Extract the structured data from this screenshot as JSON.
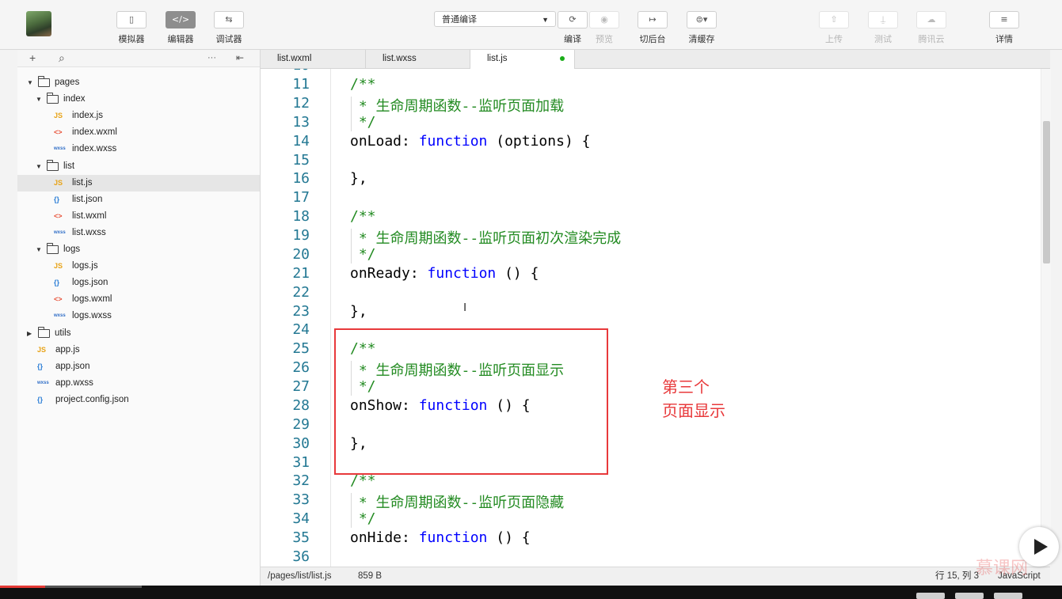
{
  "toolbar": {
    "simulator_label": "模拟器",
    "editor_label": "编辑器",
    "debugger_label": "调试器",
    "compile_mode": "普通编译",
    "compile_label": "编译",
    "preview_label": "预览",
    "background_label": "切后台",
    "clear_cache_label": "清缓存",
    "upload_label": "上传",
    "test_label": "测试",
    "tencent_cloud_label": "腾讯云",
    "details_label": "详情",
    "simulator_icon": "▯",
    "editor_icon": "</>",
    "debugger_icon": "⇆",
    "compile_icon": "⟳",
    "preview_icon": "◉",
    "background_icon": "↦",
    "clear_cache_icon": "⊜▾",
    "upload_icon": "⇧",
    "test_icon": "⍊",
    "tencent_cloud_icon": "☁",
    "details_icon": "≡"
  },
  "sidebar": {
    "add_icon": "+",
    "search_icon": "⌕",
    "more_icon": "···",
    "collapse_icon": "⇤",
    "tree": [
      {
        "label": "pages",
        "type": "folder",
        "open": true,
        "depth": 0
      },
      {
        "label": "index",
        "type": "folder",
        "open": true,
        "depth": 1
      },
      {
        "label": "index.js",
        "type": "js",
        "depth": 2,
        "icon": "JS"
      },
      {
        "label": "index.wxml",
        "type": "wxml",
        "depth": 2,
        "icon": "<>"
      },
      {
        "label": "index.wxss",
        "type": "wxss",
        "depth": 2,
        "icon": "wxss"
      },
      {
        "label": "list",
        "type": "folder",
        "open": true,
        "depth": 1
      },
      {
        "label": "list.js",
        "type": "js",
        "depth": 2,
        "icon": "JS",
        "selected": true
      },
      {
        "label": "list.json",
        "type": "json",
        "depth": 2,
        "icon": "{}"
      },
      {
        "label": "list.wxml",
        "type": "wxml",
        "depth": 2,
        "icon": "<>"
      },
      {
        "label": "list.wxss",
        "type": "wxss",
        "depth": 2,
        "icon": "wxss"
      },
      {
        "label": "logs",
        "type": "folder",
        "open": true,
        "depth": 1
      },
      {
        "label": "logs.js",
        "type": "js",
        "depth": 2,
        "icon": "JS"
      },
      {
        "label": "logs.json",
        "type": "json",
        "depth": 2,
        "icon": "{}"
      },
      {
        "label": "logs.wxml",
        "type": "wxml",
        "depth": 2,
        "icon": "<>"
      },
      {
        "label": "logs.wxss",
        "type": "wxss",
        "depth": 2,
        "icon": "wxss"
      },
      {
        "label": "utils",
        "type": "folder",
        "open": false,
        "depth": 0
      },
      {
        "label": "app.js",
        "type": "js",
        "depth": 0,
        "icon": "JS"
      },
      {
        "label": "app.json",
        "type": "json",
        "depth": 0,
        "icon": "{}"
      },
      {
        "label": "app.wxss",
        "type": "wxss",
        "depth": 0,
        "icon": "wxss"
      },
      {
        "label": "project.config.json",
        "type": "json",
        "depth": 0,
        "icon": "{}"
      }
    ]
  },
  "tabs": [
    {
      "label": "list.wxml",
      "active": false
    },
    {
      "label": "list.wxss",
      "active": false
    },
    {
      "label": "list.js",
      "active": true,
      "modified": true
    }
  ],
  "code": {
    "first_partial_line": "10",
    "lines": [
      {
        "n": "11",
        "parts": [
          [
            "cm",
            "/**"
          ]
        ]
      },
      {
        "n": "12",
        "parts": [
          [
            "cm",
            " * 生命周期函数--监听页面加载"
          ]
        ]
      },
      {
        "n": "13",
        "parts": [
          [
            "cm",
            " */"
          ]
        ]
      },
      {
        "n": "14",
        "parts": [
          [
            "",
            "onLoad: "
          ],
          [
            "kw",
            "function"
          ],
          [
            "",
            " (options) {"
          ]
        ]
      },
      {
        "n": "15",
        "parts": []
      },
      {
        "n": "16",
        "parts": [
          [
            "",
            "},"
          ]
        ]
      },
      {
        "n": "17",
        "parts": []
      },
      {
        "n": "18",
        "parts": [
          [
            "cm",
            "/**"
          ]
        ]
      },
      {
        "n": "19",
        "parts": [
          [
            "cm",
            " * 生命周期函数--监听页面初次渲染完成"
          ]
        ]
      },
      {
        "n": "20",
        "parts": [
          [
            "cm",
            " */"
          ]
        ]
      },
      {
        "n": "21",
        "parts": [
          [
            "",
            "onReady: "
          ],
          [
            "kw",
            "function"
          ],
          [
            "",
            " () {"
          ]
        ]
      },
      {
        "n": "22",
        "parts": []
      },
      {
        "n": "23",
        "parts": [
          [
            "",
            "},"
          ]
        ]
      },
      {
        "n": "24",
        "parts": []
      },
      {
        "n": "25",
        "parts": [
          [
            "cm",
            "/**"
          ]
        ]
      },
      {
        "n": "26",
        "parts": [
          [
            "cm",
            " * 生命周期函数--监听页面显示"
          ]
        ]
      },
      {
        "n": "27",
        "parts": [
          [
            "cm",
            " */"
          ]
        ]
      },
      {
        "n": "28",
        "parts": [
          [
            "",
            "onShow: "
          ],
          [
            "kw",
            "function"
          ],
          [
            "",
            " () {"
          ]
        ]
      },
      {
        "n": "29",
        "parts": []
      },
      {
        "n": "30",
        "parts": [
          [
            "",
            "},"
          ]
        ]
      },
      {
        "n": "31",
        "parts": []
      },
      {
        "n": "32",
        "parts": [
          [
            "cm",
            "/**"
          ]
        ]
      },
      {
        "n": "33",
        "parts": [
          [
            "cm",
            " * 生命周期函数--监听页面隐藏"
          ]
        ]
      },
      {
        "n": "34",
        "parts": [
          [
            "cm",
            " */"
          ]
        ]
      },
      {
        "n": "35",
        "parts": [
          [
            "",
            "onHide: "
          ],
          [
            "kw",
            "function"
          ],
          [
            "",
            " () {"
          ]
        ]
      },
      {
        "n": "36",
        "parts": []
      }
    ]
  },
  "annotation": {
    "line1": "第三个",
    "line2": "页面显示"
  },
  "status": {
    "path": "/pages/list/list.js",
    "size": "859 B",
    "position": "行 15, 列 3",
    "language": "JavaScript"
  },
  "watermark": "慕课网",
  "colors": {
    "comment": "#238b22",
    "keyword": "#0000ff",
    "line_number": "#237893",
    "annotation": "#e8393b"
  }
}
